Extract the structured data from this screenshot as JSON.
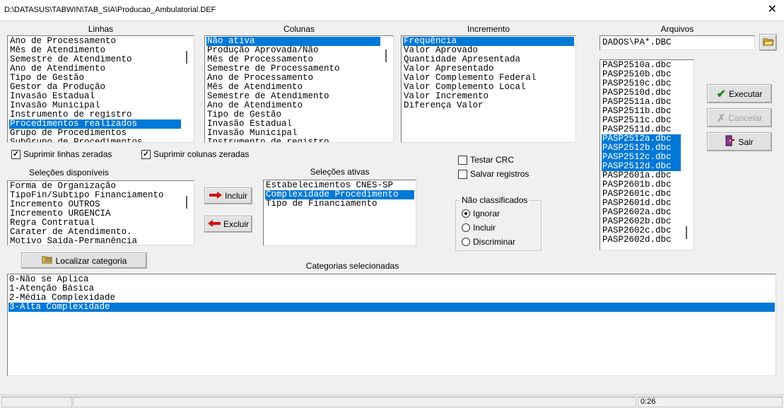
{
  "window": {
    "title": "D:\\DATASUS\\TABWIN\\TAB_SIA\\Producao_Ambulatorial.DEF",
    "close": "✕"
  },
  "labels": {
    "linhas": "Linhas",
    "colunas": "Colunas",
    "incremento": "Incremento",
    "arquivos": "Arquivos",
    "selecoes_disponiveis": "Seleções disponíveis",
    "selecoes_ativas": "Seleções ativas",
    "categorias_selecionadas": "Categorias selecionadas"
  },
  "linhas": [
    "Ano de Processamento",
    "Mês de Atendimento",
    "Semestre de Atendimento",
    "Ano de Atendimento",
    "Tipo de Gestão",
    "Gestor da Produção",
    "Invasão Estadual",
    "Invasão Municipal",
    "Instrumento de registro",
    "Procedimentos realizados",
    "Grupo de Procedimentos",
    "SubGrupo de Procedimentos"
  ],
  "linhas_selected": 9,
  "colunas": [
    "Não ativa",
    "Produção Aprovada/Não",
    "Mês de Processamento",
    "Semestre de Processamento",
    "Ano de Processamento",
    "Mês de Atendimento",
    "Semestre de Atendimento",
    "Ano de Atendimento",
    "Tipo de Gestão",
    "Invasão Estadual",
    "Invasão Municipal",
    "Instrumento de registro"
  ],
  "colunas_selected": 0,
  "incremento": [
    "Frequência",
    "Valor Aprovado",
    "Quantidade Apresentada",
    "Valor Apresentado",
    "Valor Complemento Federal",
    "Valor Complemento Local",
    "Valor Incremento",
    "Diferença Valor"
  ],
  "incremento_selected": 0,
  "arquivos": {
    "pattern": "DADOS\\PA*.DBC",
    "files": [
      "PASP2510a.dbc",
      "PASP2510b.dbc",
      "PASP2510c.dbc",
      "PASP2510d.dbc",
      "PASP2511a.dbc",
      "PASP2511b.dbc",
      "PASP2511c.dbc",
      "PASP2511d.dbc",
      "PASP2512a.dbc",
      "PASP2512b.dbc",
      "PASP2512c.dbc",
      "PASP2512d.dbc",
      "PASP2601a.dbc",
      "PASP2601b.dbc",
      "PASP2601c.dbc",
      "PASP2601d.dbc",
      "PASP2602a.dbc",
      "PASP2602b.dbc",
      "PASP2602c.dbc",
      "PASP2602d.dbc"
    ],
    "selected": [
      8,
      9,
      10,
      11
    ]
  },
  "buttons": {
    "executar": "Executar",
    "cancelar": "Cancelar",
    "sair": "Sair",
    "incluir": "Incluir",
    "excluir": "Excluir",
    "localizar": "Localizar categoria"
  },
  "checks": {
    "suprimir_linhas": "Suprimir linhas zeradas",
    "suprimir_colunas": "Suprimir colunas zeradas",
    "testar_crc": "Testar CRC",
    "salvar_registros": "Salvar registros"
  },
  "nao_classificados": {
    "legend": "Não classificados",
    "options": [
      "Ignorar",
      "Incluir",
      "Discriminar"
    ],
    "selected": 0
  },
  "selecoes_disponiveis": [
    "Forma de  Organização",
    "TipoFin/Subtipo Financiamento",
    "Incremento OUTROS",
    "Incremento URGENCIA",
    "Regra Contratual",
    "Carater de Atendimento.",
    "Motivo Saída-Permanência"
  ],
  "selecoes_ativas": [
    "Estabelecimentos CNES-SP",
    "Complexidade Procedimento",
    "Tipo de Financiamento"
  ],
  "selecoes_ativas_selected": 1,
  "categorias": [
    "0-Não se Aplica",
    "1-Atenção Básica",
    "2-Média Complexidade",
    "3-Alta Complexidade"
  ],
  "categorias_selected": 3,
  "status": {
    "time": "0:26"
  }
}
